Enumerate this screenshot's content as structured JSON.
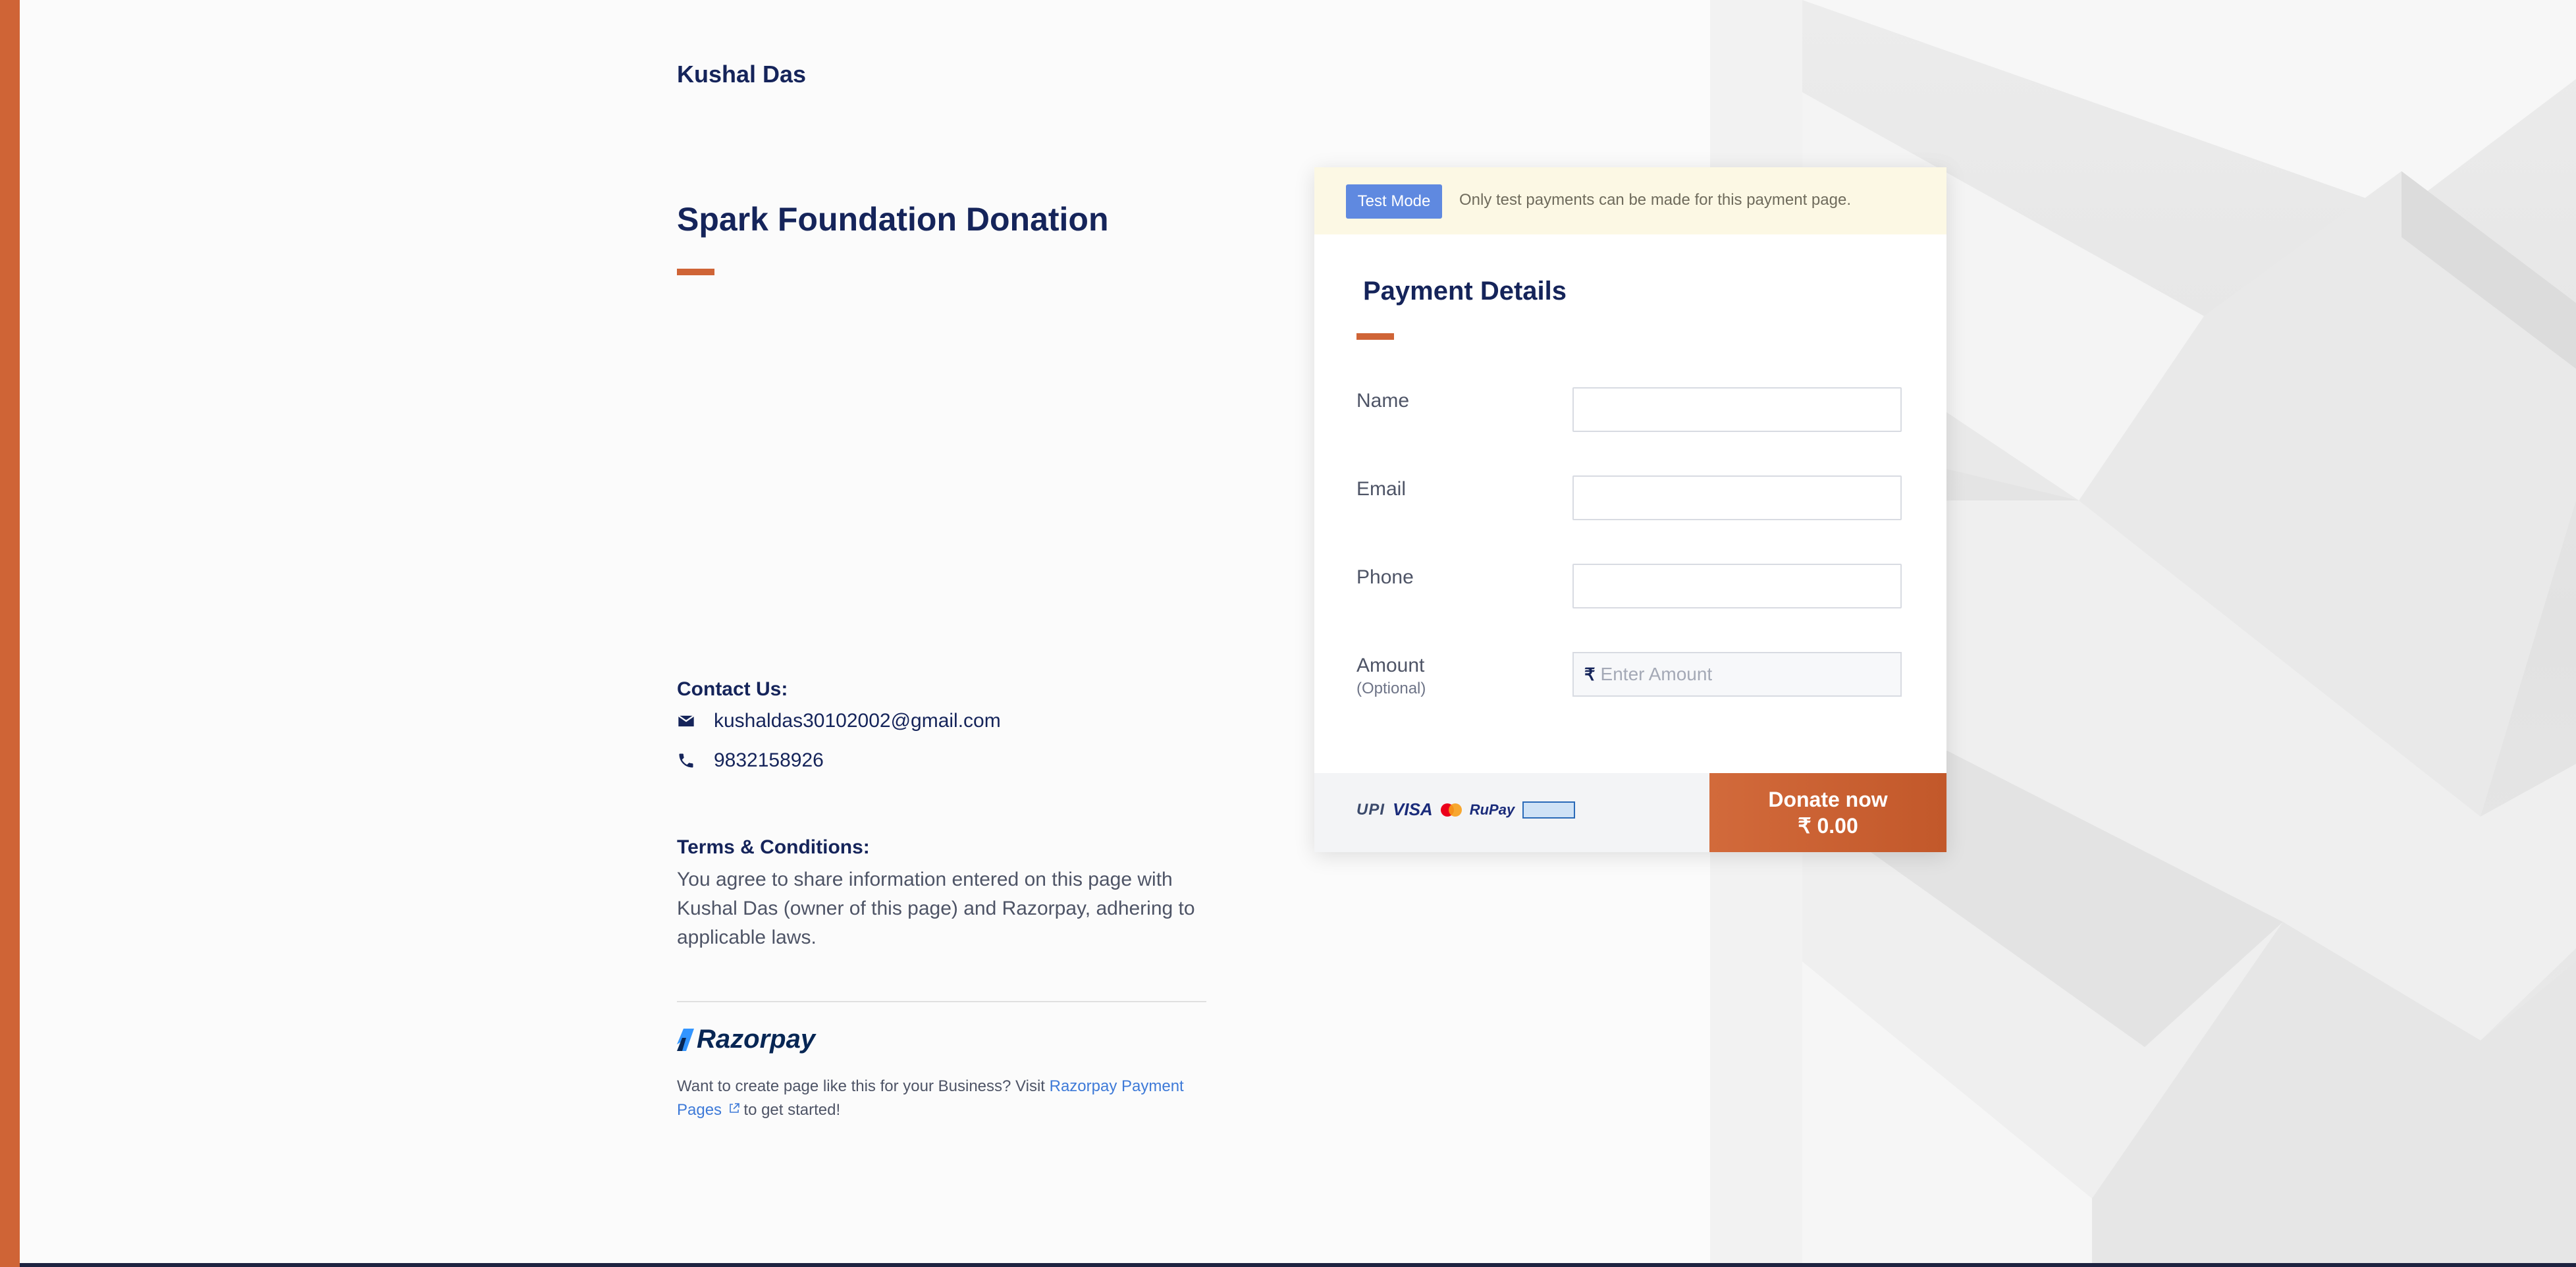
{
  "header": {
    "merchant_name": "Kushal Das"
  },
  "page": {
    "title": "Spark Foundation Donation"
  },
  "contact": {
    "heading": "Contact Us:",
    "email": "kushaldas30102002@gmail.com",
    "phone": "9832158926",
    "email_icon": "mail-icon",
    "phone_icon": "phone-icon"
  },
  "terms": {
    "heading": "Terms & Conditions:",
    "text": "You agree to share information entered on this page with Kushal Das (owner of this page) and Razorpay, adhering to applicable laws."
  },
  "footer": {
    "logo_text": "Razorpay",
    "text_before": "Want to create page like this for your Business? Visit ",
    "link_text": "Razorpay Payment Pages",
    "text_after": " to get started!",
    "link_icon": "external-link-icon"
  },
  "card": {
    "test_badge": "Test Mode",
    "test_message": "Only test payments can be made for this payment page.",
    "title": "Payment Details",
    "fields": {
      "name_label": "Name",
      "email_label": "Email",
      "phone_label": "Phone",
      "amount_label": "Amount",
      "amount_sub": "(Optional)",
      "amount_placeholder": "Enter Amount",
      "currency_symbol": "₹"
    },
    "payment_logos": {
      "upi": "UPI",
      "visa": "VISA",
      "rupay": "RuPay"
    },
    "donate": {
      "label": "Donate now",
      "amount": "₹ 0.00"
    }
  },
  "colors": {
    "accent": "#cf6436",
    "navy": "#15245a",
    "link": "#3e7ad8",
    "test_badge": "#5f89e0"
  }
}
